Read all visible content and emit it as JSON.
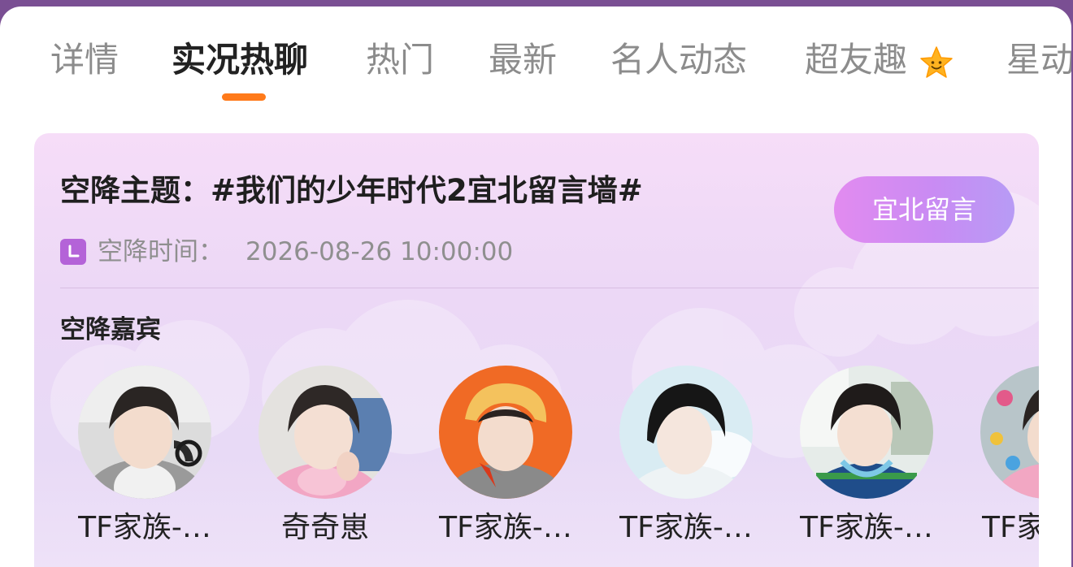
{
  "tabs": [
    {
      "label": "详情",
      "active": false
    },
    {
      "label": "实况热聊",
      "active": true
    },
    {
      "label": "热门",
      "active": false
    },
    {
      "label": "最新",
      "active": false
    },
    {
      "label": "名人动态",
      "active": false
    },
    {
      "label": "超友趣",
      "active": false,
      "icon": "star-face-icon"
    },
    {
      "label": "星动",
      "active": false
    }
  ],
  "card": {
    "topic": "空降主题：#我们的少年时代2宜北留言墙#",
    "cta_label": "宜北留言",
    "time_label": "空降时间：",
    "time_value": "2026-08-26 10:00:00",
    "guests_title": "空降嘉宾",
    "guests": [
      {
        "name": "TF家族-…"
      },
      {
        "name": "奇奇崽"
      },
      {
        "name": "TF家族-…"
      },
      {
        "name": "TF家族-…"
      },
      {
        "name": "TF家族-…"
      },
      {
        "name": "TF家"
      }
    ]
  },
  "colors": {
    "accent_orange": "#ff7a1a",
    "cta_start": "#e28bf0",
    "cta_end": "#b79bf5",
    "header_purple": "#7a4f93"
  }
}
